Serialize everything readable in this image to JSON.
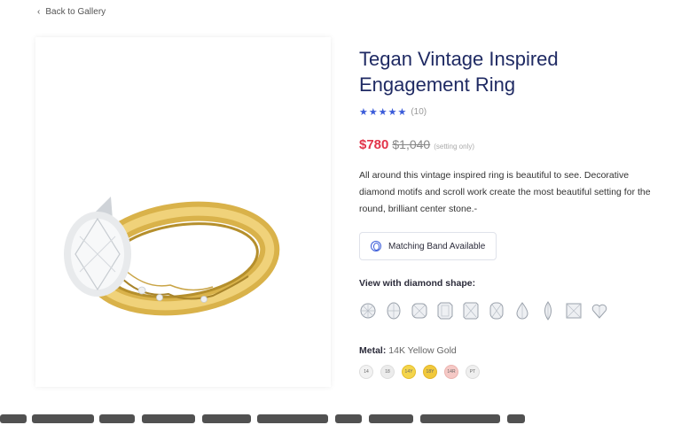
{
  "nav": {
    "back_label": "Back to Gallery"
  },
  "product": {
    "title": "Tegan Vintage Inspired Engagement Ring",
    "stars": "★★★★★",
    "review_count": "(10)",
    "price_sale": "$780",
    "price_original": "$1,040",
    "price_note": "(setting only)",
    "description": "All around this vintage inspired ring is beautiful to see. Decorative diamond motifs and scroll work create the most beautiful setting for the round, brilliant center stone.-",
    "matching_band_label": "Matching Band Available",
    "image_alt": "product-image"
  },
  "diamond_shapes": {
    "heading": "View with diamond shape:",
    "items": [
      {
        "icon": "round-shape-icon"
      },
      {
        "icon": "oval-shape-icon"
      },
      {
        "icon": "cushion-shape-icon"
      },
      {
        "icon": "emerald-shape-icon"
      },
      {
        "icon": "radiant-shape-icon"
      },
      {
        "icon": "elongated-cushion-shape-icon"
      },
      {
        "icon": "pear-shape-icon"
      },
      {
        "icon": "marquise-shape-icon"
      },
      {
        "icon": "princess-shape-icon"
      },
      {
        "icon": "heart-shape-icon"
      }
    ]
  },
  "metal": {
    "label": "Metal:",
    "value": "14K Yellow Gold",
    "options": [
      {
        "code": "14",
        "color": "#f2f2f2"
      },
      {
        "code": "18",
        "color": "#ececec"
      },
      {
        "code": "14Y",
        "color": "#f4d54c"
      },
      {
        "code": "18Y",
        "color": "#f1c93c"
      },
      {
        "code": "14R",
        "color": "#f5c9c6"
      },
      {
        "code": "PT",
        "color": "#efefef"
      }
    ]
  },
  "colors": {
    "title": "#1f2a63",
    "accent": "#3a5bd9",
    "sale": "#e2344a"
  }
}
